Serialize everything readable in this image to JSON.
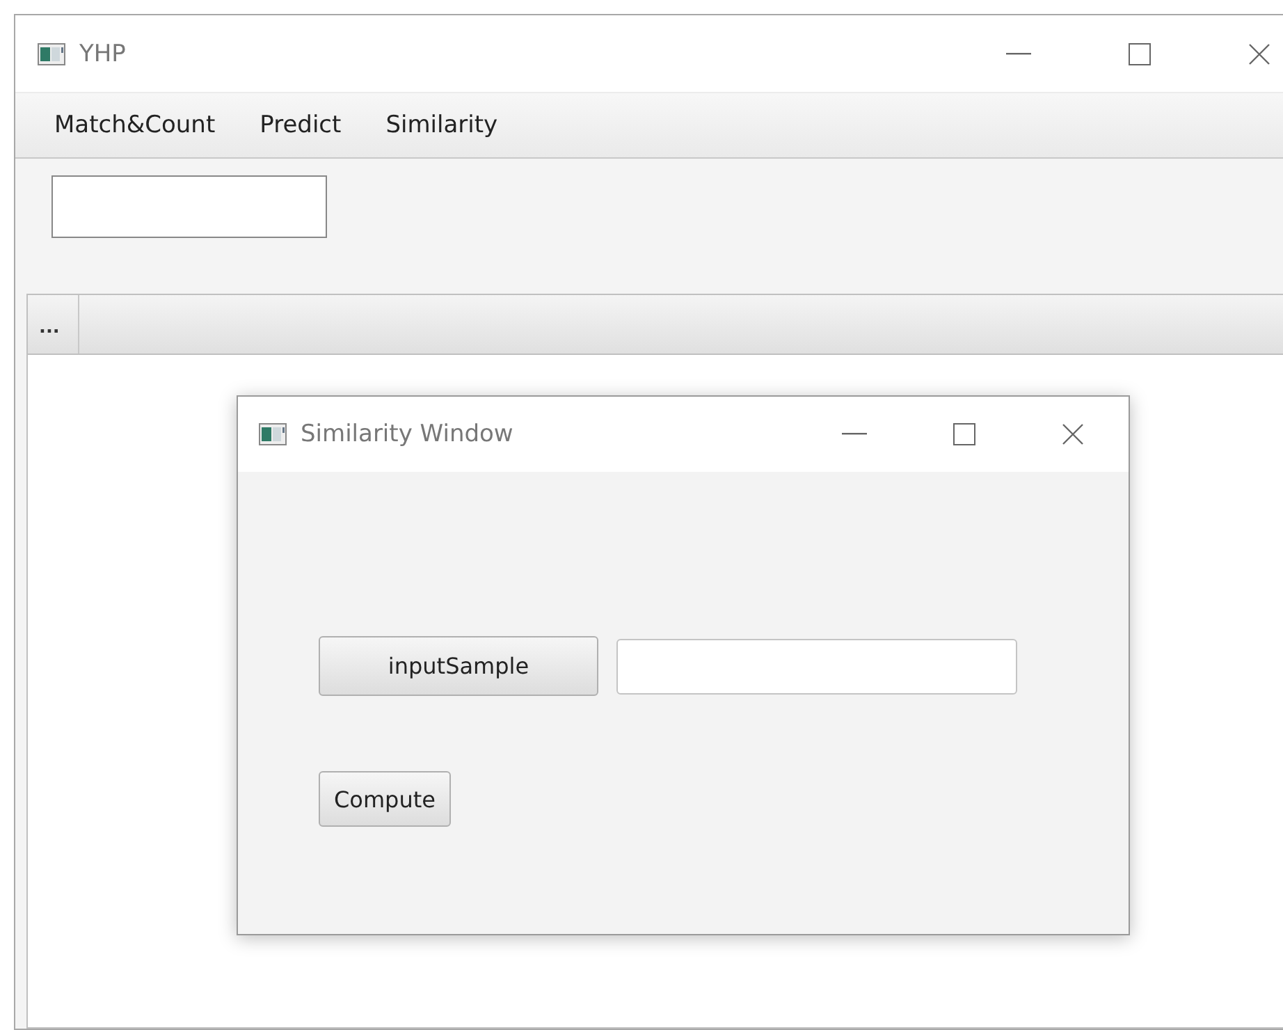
{
  "window": {
    "title": "YHP"
  },
  "menu": [
    "Match&Count",
    "Predict",
    "Similarity"
  ],
  "table": {
    "columns": [
      "..."
    ]
  },
  "dialog": {
    "title": "Similarity Window",
    "sample_button": "inputSample",
    "compute_button": "Compute"
  }
}
